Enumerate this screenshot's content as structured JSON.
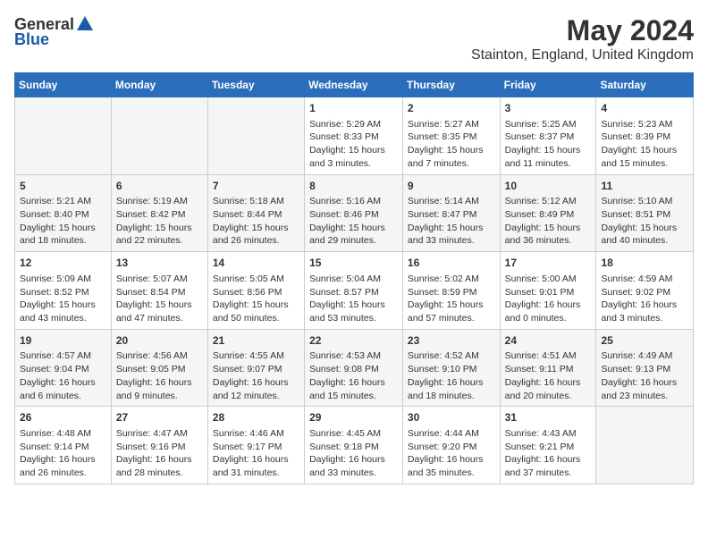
{
  "logo": {
    "general": "General",
    "blue": "Blue"
  },
  "title": "May 2024",
  "location": "Stainton, England, United Kingdom",
  "days_of_week": [
    "Sunday",
    "Monday",
    "Tuesday",
    "Wednesday",
    "Thursday",
    "Friday",
    "Saturday"
  ],
  "rows": [
    [
      {
        "day": "",
        "content": ""
      },
      {
        "day": "",
        "content": ""
      },
      {
        "day": "",
        "content": ""
      },
      {
        "day": "1",
        "content": "Sunrise: 5:29 AM\nSunset: 8:33 PM\nDaylight: 15 hours\nand 3 minutes."
      },
      {
        "day": "2",
        "content": "Sunrise: 5:27 AM\nSunset: 8:35 PM\nDaylight: 15 hours\nand 7 minutes."
      },
      {
        "day": "3",
        "content": "Sunrise: 5:25 AM\nSunset: 8:37 PM\nDaylight: 15 hours\nand 11 minutes."
      },
      {
        "day": "4",
        "content": "Sunrise: 5:23 AM\nSunset: 8:39 PM\nDaylight: 15 hours\nand 15 minutes."
      }
    ],
    [
      {
        "day": "5",
        "content": "Sunrise: 5:21 AM\nSunset: 8:40 PM\nDaylight: 15 hours\nand 18 minutes."
      },
      {
        "day": "6",
        "content": "Sunrise: 5:19 AM\nSunset: 8:42 PM\nDaylight: 15 hours\nand 22 minutes."
      },
      {
        "day": "7",
        "content": "Sunrise: 5:18 AM\nSunset: 8:44 PM\nDaylight: 15 hours\nand 26 minutes."
      },
      {
        "day": "8",
        "content": "Sunrise: 5:16 AM\nSunset: 8:46 PM\nDaylight: 15 hours\nand 29 minutes."
      },
      {
        "day": "9",
        "content": "Sunrise: 5:14 AM\nSunset: 8:47 PM\nDaylight: 15 hours\nand 33 minutes."
      },
      {
        "day": "10",
        "content": "Sunrise: 5:12 AM\nSunset: 8:49 PM\nDaylight: 15 hours\nand 36 minutes."
      },
      {
        "day": "11",
        "content": "Sunrise: 5:10 AM\nSunset: 8:51 PM\nDaylight: 15 hours\nand 40 minutes."
      }
    ],
    [
      {
        "day": "12",
        "content": "Sunrise: 5:09 AM\nSunset: 8:52 PM\nDaylight: 15 hours\nand 43 minutes."
      },
      {
        "day": "13",
        "content": "Sunrise: 5:07 AM\nSunset: 8:54 PM\nDaylight: 15 hours\nand 47 minutes."
      },
      {
        "day": "14",
        "content": "Sunrise: 5:05 AM\nSunset: 8:56 PM\nDaylight: 15 hours\nand 50 minutes."
      },
      {
        "day": "15",
        "content": "Sunrise: 5:04 AM\nSunset: 8:57 PM\nDaylight: 15 hours\nand 53 minutes."
      },
      {
        "day": "16",
        "content": "Sunrise: 5:02 AM\nSunset: 8:59 PM\nDaylight: 15 hours\nand 57 minutes."
      },
      {
        "day": "17",
        "content": "Sunrise: 5:00 AM\nSunset: 9:01 PM\nDaylight: 16 hours\nand 0 minutes."
      },
      {
        "day": "18",
        "content": "Sunrise: 4:59 AM\nSunset: 9:02 PM\nDaylight: 16 hours\nand 3 minutes."
      }
    ],
    [
      {
        "day": "19",
        "content": "Sunrise: 4:57 AM\nSunset: 9:04 PM\nDaylight: 16 hours\nand 6 minutes."
      },
      {
        "day": "20",
        "content": "Sunrise: 4:56 AM\nSunset: 9:05 PM\nDaylight: 16 hours\nand 9 minutes."
      },
      {
        "day": "21",
        "content": "Sunrise: 4:55 AM\nSunset: 9:07 PM\nDaylight: 16 hours\nand 12 minutes."
      },
      {
        "day": "22",
        "content": "Sunrise: 4:53 AM\nSunset: 9:08 PM\nDaylight: 16 hours\nand 15 minutes."
      },
      {
        "day": "23",
        "content": "Sunrise: 4:52 AM\nSunset: 9:10 PM\nDaylight: 16 hours\nand 18 minutes."
      },
      {
        "day": "24",
        "content": "Sunrise: 4:51 AM\nSunset: 9:11 PM\nDaylight: 16 hours\nand 20 minutes."
      },
      {
        "day": "25",
        "content": "Sunrise: 4:49 AM\nSunset: 9:13 PM\nDaylight: 16 hours\nand 23 minutes."
      }
    ],
    [
      {
        "day": "26",
        "content": "Sunrise: 4:48 AM\nSunset: 9:14 PM\nDaylight: 16 hours\nand 26 minutes."
      },
      {
        "day": "27",
        "content": "Sunrise: 4:47 AM\nSunset: 9:16 PM\nDaylight: 16 hours\nand 28 minutes."
      },
      {
        "day": "28",
        "content": "Sunrise: 4:46 AM\nSunset: 9:17 PM\nDaylight: 16 hours\nand 31 minutes."
      },
      {
        "day": "29",
        "content": "Sunrise: 4:45 AM\nSunset: 9:18 PM\nDaylight: 16 hours\nand 33 minutes."
      },
      {
        "day": "30",
        "content": "Sunrise: 4:44 AM\nSunset: 9:20 PM\nDaylight: 16 hours\nand 35 minutes."
      },
      {
        "day": "31",
        "content": "Sunrise: 4:43 AM\nSunset: 9:21 PM\nDaylight: 16 hours\nand 37 minutes."
      },
      {
        "day": "",
        "content": ""
      }
    ]
  ]
}
